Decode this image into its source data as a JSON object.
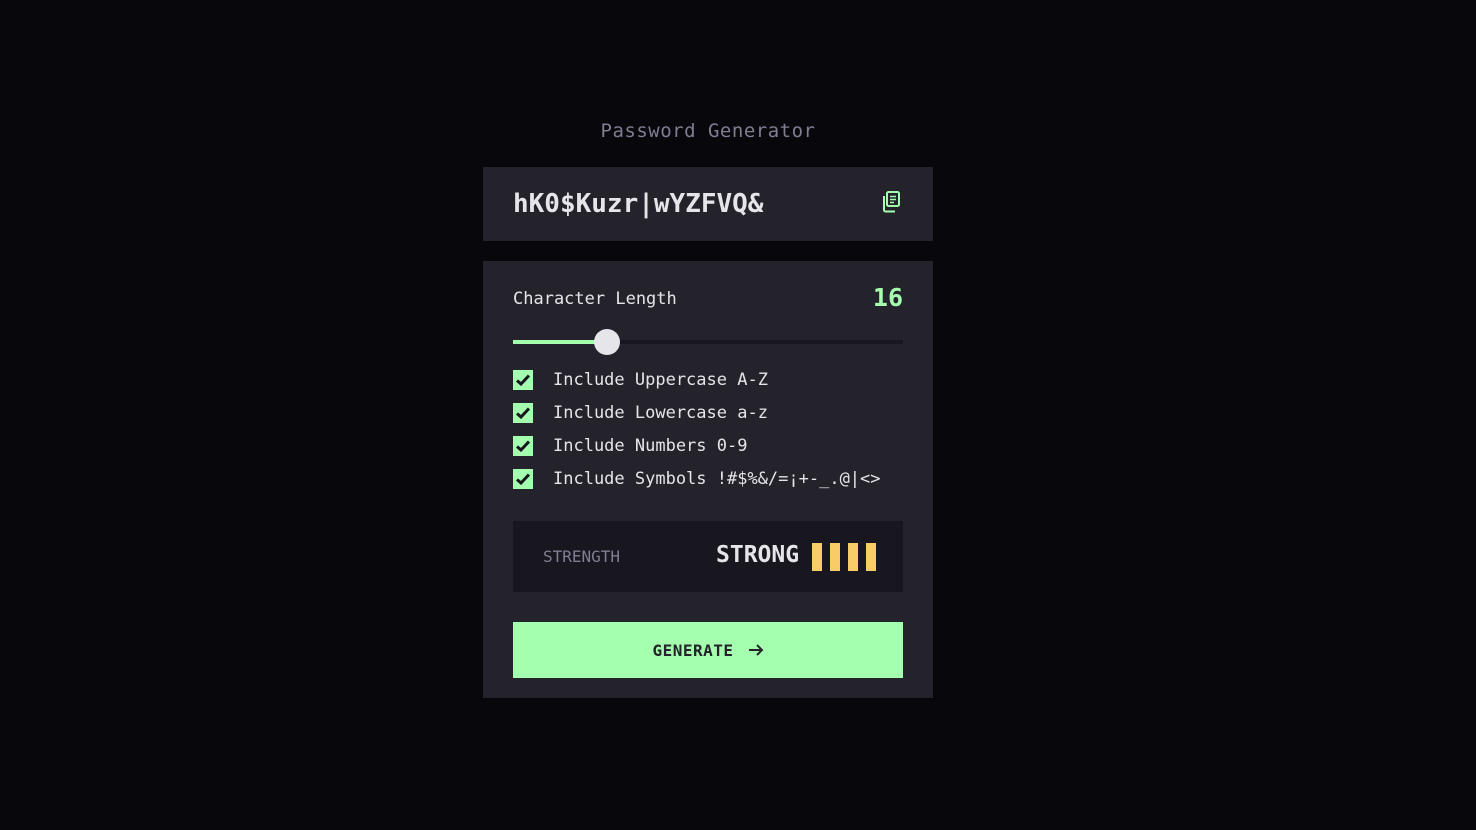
{
  "app": {
    "title": "Password Generator"
  },
  "password": {
    "value": "hK0$Kuzr|wYZFVQ&",
    "copy_icon": "copy-icon"
  },
  "length": {
    "label": "Character Length",
    "value": "16",
    "slider_fraction": 0.24
  },
  "options": [
    {
      "label": "Include Uppercase A-Z",
      "checked": true
    },
    {
      "label": "Include Lowercase a-z",
      "checked": true
    },
    {
      "label": "Include Numbers 0-9",
      "checked": true
    },
    {
      "label": "Include Symbols !#$%&/=¡+-_.@|<>",
      "checked": true
    }
  ],
  "strength": {
    "label": "STRENGTH",
    "value": "STRONG",
    "filled_bars": 4,
    "total_bars": 4,
    "bar_color": "#f8cd65"
  },
  "generate": {
    "label": "GENERATE",
    "icon": "arrow-right-icon"
  },
  "colors": {
    "accent": "#a4ffaf",
    "background": "#08070b",
    "panel": "#24232c",
    "text": "#e6e5ea",
    "muted": "#817d92"
  }
}
